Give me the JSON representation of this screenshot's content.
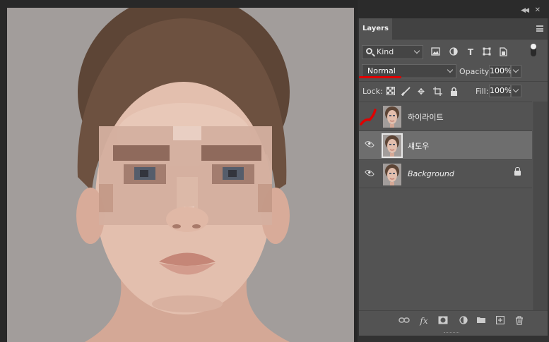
{
  "panel": {
    "collapse_icon": "double-chevron-icon",
    "close_icon": "close-icon",
    "tab_label": "Layers"
  },
  "filter": {
    "kind_label": "Kind",
    "icons": [
      "image-filter-icon",
      "adjustment-filter-icon",
      "type-filter-icon",
      "shape-filter-icon",
      "smart-object-filter-icon"
    ]
  },
  "blend": {
    "mode": "Normal",
    "opacity_label": "Opacity:",
    "opacity_value": "100%"
  },
  "lock": {
    "label": "Lock:",
    "fill_label": "Fill:",
    "fill_value": "100%"
  },
  "layers": [
    {
      "name": "하이라이트",
      "visible": false,
      "selected": false,
      "locked": false
    },
    {
      "name": "섀도우",
      "visible": true,
      "selected": true,
      "locked": false
    },
    {
      "name": "Background",
      "visible": true,
      "selected": false,
      "locked": true
    }
  ],
  "bottom_icons": [
    "link-layers-icon",
    "fx-icon",
    "add-mask-icon",
    "new-adjustment-icon",
    "new-group-icon",
    "new-layer-icon",
    "delete-layer-icon"
  ],
  "fx_text": "fx",
  "colors": {
    "annotation_red": "#e00000",
    "panel_bg": "#535353",
    "selected_layer": "#6e6e6e"
  }
}
